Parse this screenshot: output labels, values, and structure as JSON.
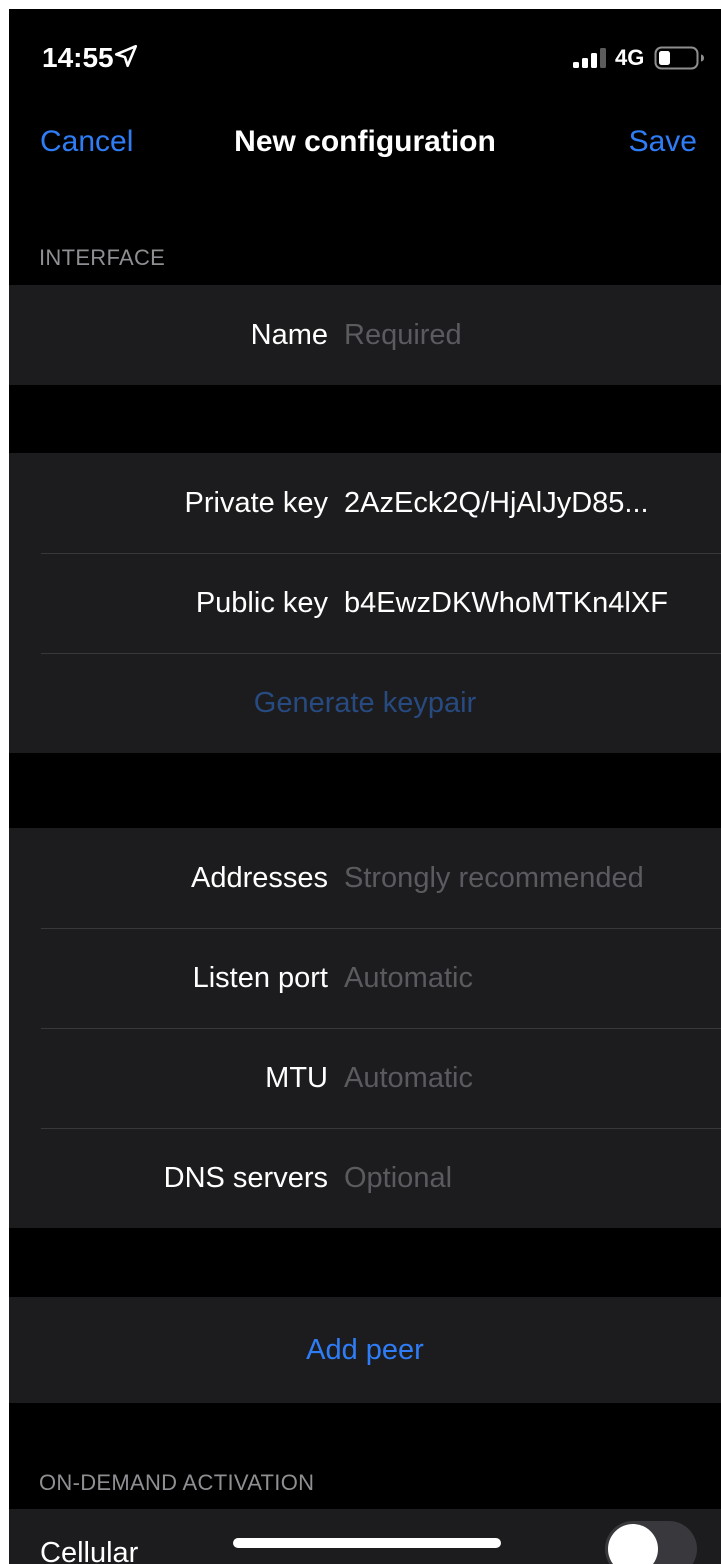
{
  "status_bar": {
    "time": "14:55",
    "location_icon": "location-arrow-icon",
    "signal_icon": "cellular-signal-icon",
    "network": "4G",
    "battery_icon": "battery-low-icon"
  },
  "nav": {
    "cancel_label": "Cancel",
    "title": "New configuration",
    "save_label": "Save"
  },
  "interface": {
    "section_title": "INTERFACE",
    "name": {
      "label": "Name",
      "placeholder": "Required"
    },
    "private_key": {
      "label": "Private key",
      "value": "2AzEck2Q/HjAlJyD85..."
    },
    "public_key": {
      "label": "Public key",
      "value": "b4EwzDKWhoMTKn4lXF"
    },
    "generate_label": "Generate keypair",
    "addresses": {
      "label": "Addresses",
      "placeholder": "Strongly recommended"
    },
    "listen_port": {
      "label": "Listen port",
      "placeholder": "Automatic"
    },
    "mtu": {
      "label": "MTU",
      "placeholder": "Automatic"
    },
    "dns_servers": {
      "label": "DNS servers",
      "placeholder": "Optional"
    }
  },
  "add_peer_label": "Add peer",
  "on_demand": {
    "section_title": "ON-DEMAND ACTIVATION",
    "cellular_label": "Cellular",
    "cellular_enabled": false
  },
  "colors": {
    "background": "#000000",
    "cell_background": "#1c1c1e",
    "accent": "#2f7df6",
    "placeholder": "#5a5a5f",
    "section_header": "#8e8e93"
  }
}
